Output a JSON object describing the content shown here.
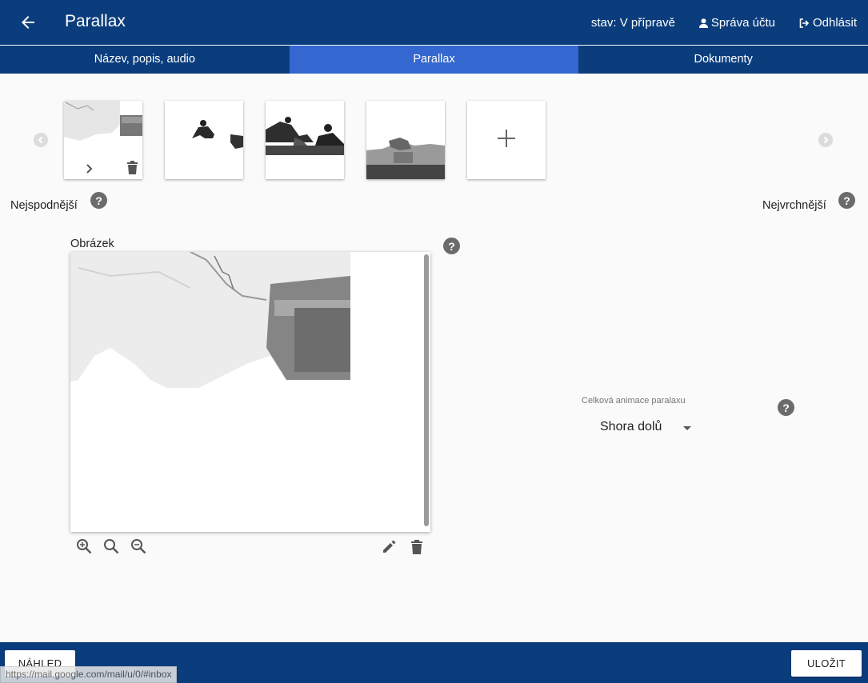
{
  "header": {
    "title": "Parallax",
    "status": "stav: V přípravě",
    "account": "Správa účtu",
    "logout": "Odhlásit",
    "icons": {
      "back": "arrow-left-icon",
      "account": "user-icon",
      "logout": "sign-out-icon"
    }
  },
  "tabs": [
    {
      "label": "Název, popis, audio",
      "active": false
    },
    {
      "label": "Parallax",
      "active": true
    },
    {
      "label": "Dokumenty",
      "active": false
    }
  ],
  "layers": {
    "bottom_label": "Nejspodnější",
    "top_label": "Nejvrchnější",
    "add_symbol": "+",
    "thumbnails": [
      "layer-1",
      "layer-2",
      "layer-3",
      "layer-4"
    ]
  },
  "image_panel": {
    "label": "Obrázek",
    "tools": [
      "zoom-in-icon",
      "zoom-reset-icon",
      "zoom-out-icon",
      "edit-icon",
      "delete-icon"
    ]
  },
  "animation": {
    "caption": "Celková animace paralaxu",
    "value": "Shora dolů"
  },
  "footer": {
    "preview": "NÁHLED",
    "save": "ULOŽIT",
    "status_url": "https://mail.google.com/mail/u/0/#inbox"
  },
  "help_symbol": "?",
  "colors": {
    "primary": "#0b3d7c",
    "active_tab": "#3467cf",
    "help": "#6b6b6b"
  }
}
